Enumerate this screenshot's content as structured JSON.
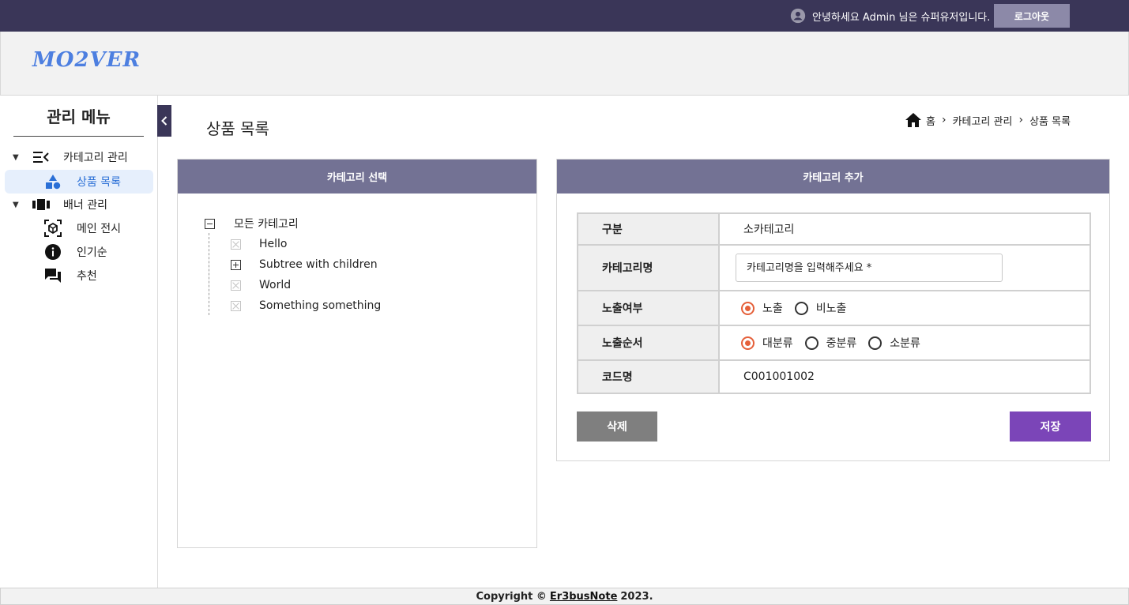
{
  "topbar": {
    "greeting": "안녕하세요 Admin 님은 슈퍼유저입니다.",
    "logout_label": "로그아웃",
    "user_icon": "account-circle-icon"
  },
  "header": {
    "logo": "MO2VER"
  },
  "sidebar": {
    "title": "관리 메뉴",
    "groups": [
      {
        "label": "카테고리 관리",
        "icon": "menu-collapse-icon",
        "expanded": true,
        "items": [
          {
            "label": "상품 목록",
            "icon": "shapes-icon",
            "active": true
          }
        ]
      },
      {
        "label": "배너 관리",
        "icon": "view-carousel-icon",
        "expanded": true,
        "items": [
          {
            "label": "메인 전시",
            "icon": "3d-box-icon"
          },
          {
            "label": "인기순",
            "icon": "info-icon"
          },
          {
            "label": "추천",
            "icon": "forum-icon"
          }
        ]
      }
    ]
  },
  "page": {
    "title": "상품 목록",
    "breadcrumb": [
      "홈",
      "카테고리 관리",
      "상품 목록"
    ]
  },
  "category_select": {
    "header": "카테고리 선택",
    "root": "모든 카테고리",
    "nodes": [
      {
        "label": "Hello",
        "type": "leaf"
      },
      {
        "label": "Subtree with children",
        "type": "collapsed"
      },
      {
        "label": "World",
        "type": "leaf"
      },
      {
        "label": "Something something",
        "type": "leaf"
      }
    ]
  },
  "category_add": {
    "header": "카테고리 추가",
    "rows": {
      "division": {
        "label": "구분",
        "value": "소카테고리"
      },
      "name": {
        "label": "카테고리명",
        "placeholder": "카테고리명을 입력해주세요 *"
      },
      "visibility": {
        "label": "노출여부",
        "options": [
          "노출",
          "비노출"
        ],
        "selected": "노출"
      },
      "order": {
        "label": "노출순서",
        "options": [
          "대분류",
          "중분류",
          "소분류"
        ],
        "selected": "대분류"
      },
      "code": {
        "label": "코드명",
        "value": "C001001002"
      }
    },
    "delete_label": "삭제",
    "save_label": "저장"
  },
  "footer": {
    "prefix": "Copyright ©",
    "link": "Er3busNote",
    "suffix": "2023."
  },
  "colors": {
    "topbar": "#3a3658",
    "panel_header": "#737294",
    "save_button": "#7b45b8",
    "delete_button": "#7f7f7f",
    "radio_accent": "#e5603a",
    "active_menu": "#2a6fd6",
    "logo": "#4d7fe0"
  }
}
